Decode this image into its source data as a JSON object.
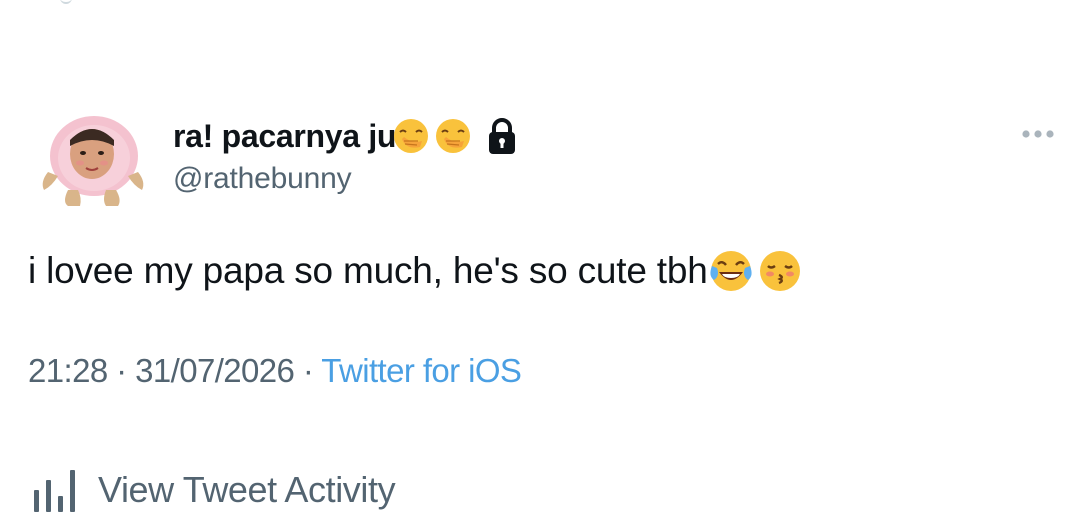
{
  "tweet": {
    "author": {
      "display_name": "ra! pacarnya ju",
      "name_emojis": [
        "hand-over-mouth-emoji",
        "hand-over-mouth-emoji"
      ],
      "protected_icon": "lock-icon",
      "handle": "@rathebunny",
      "avatar": "profile-avatar"
    },
    "more_icon": "more-dots-icon",
    "text": "i lovee my papa so much, he's so cute tbh",
    "text_emojis": [
      "tears-of-joy-emoji",
      "kissing-closed-eyes-emoji"
    ],
    "time": "21:28",
    "date": "31/07/2026",
    "separator": "·",
    "source": "Twitter for iOS",
    "activity": {
      "label": "View Tweet Activity",
      "icon": "bar-chart-icon"
    }
  },
  "colors": {
    "text_primary": "#0f1419",
    "text_secondary": "#536471",
    "link": "#4a9fe3",
    "background": "#ffffff"
  }
}
